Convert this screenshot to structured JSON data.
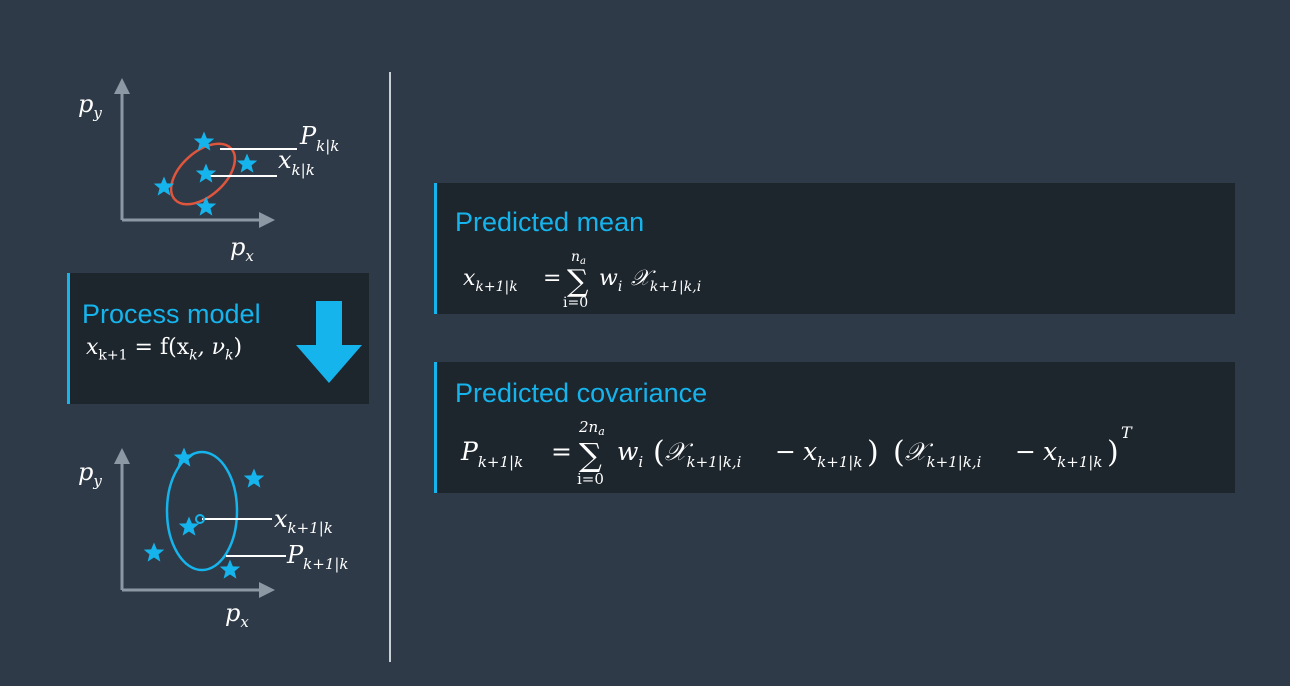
{
  "colors": {
    "background": "#2e3a47",
    "card": "#1d252d",
    "accent": "#16b4ec",
    "ellipse_before": "#e0553d",
    "ellipse_after": "#16b4ec",
    "axis": "#8c98a4"
  },
  "icons": {
    "down_arrow": "arrow-down-icon",
    "sigma_point": "star-icon"
  },
  "top_plot": {
    "y_axis_label": "p",
    "y_axis_sub": "y",
    "x_axis_label": "p",
    "x_axis_sub": "x",
    "covariance_label": "P",
    "covariance_sub": "k|k",
    "mean_label": "x",
    "mean_sub": "k|k"
  },
  "process_model": {
    "title": "Process model",
    "lhs": "x",
    "lhs_sub": "k+1",
    "rhs": " = f(x",
    "rhs_sub1": "k",
    "rhs_mid": ", ν",
    "rhs_sub2": "k",
    "rhs_end": ")"
  },
  "bottom_plot": {
    "y_axis_label": "p",
    "y_axis_sub": "y",
    "x_axis_label": "p",
    "x_axis_sub": "x",
    "mean_label": "x",
    "mean_sub": "k+1|k",
    "covariance_label": "P",
    "covariance_sub": "k+1|k"
  },
  "predicted_mean": {
    "title": "Predicted mean",
    "lhs": "x",
    "lhs_sub": "k+1|k",
    "eq": "=",
    "sum_upper": "n",
    "sum_upper_sub": "a",
    "sum_symbol": "∑",
    "sum_lower": "i=0",
    "weight": "w",
    "weight_sub": "i",
    "sigma": "𝒳",
    "sigma_sub": "k+1|k,i"
  },
  "predicted_covariance": {
    "title": "Predicted covariance",
    "lhs": "P",
    "lhs_sub": "k+1|k",
    "eq": "=",
    "sum_upper": "2n",
    "sum_upper_sub": "a",
    "sum_symbol": "∑",
    "sum_lower": "i=0",
    "weight": "w",
    "weight_sub": "i",
    "paren_open": "(",
    "sigma": "𝒳",
    "sigma_sub": "k+1|k,i",
    "minus": "−",
    "mean": "x",
    "mean_sub": "k+1|k",
    "paren_close": ")",
    "transpose": "T"
  }
}
